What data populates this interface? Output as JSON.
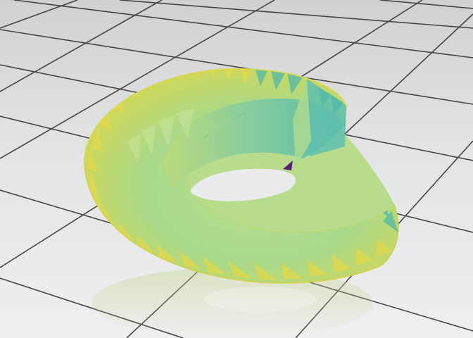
{
  "scene": {
    "subject": "mobius-strip",
    "floor_tile_color": "#e6e7e9",
    "floor_grout_color": "#2b2c2e",
    "floor_shade_color": "#c9cbce",
    "surface_colors": {
      "yellow": "#e3d84a",
      "light_green": "#b5dc8a",
      "teal": "#4fb8a8",
      "pale_green": "#cfe6a3",
      "purple": "#5b1d7a"
    }
  }
}
